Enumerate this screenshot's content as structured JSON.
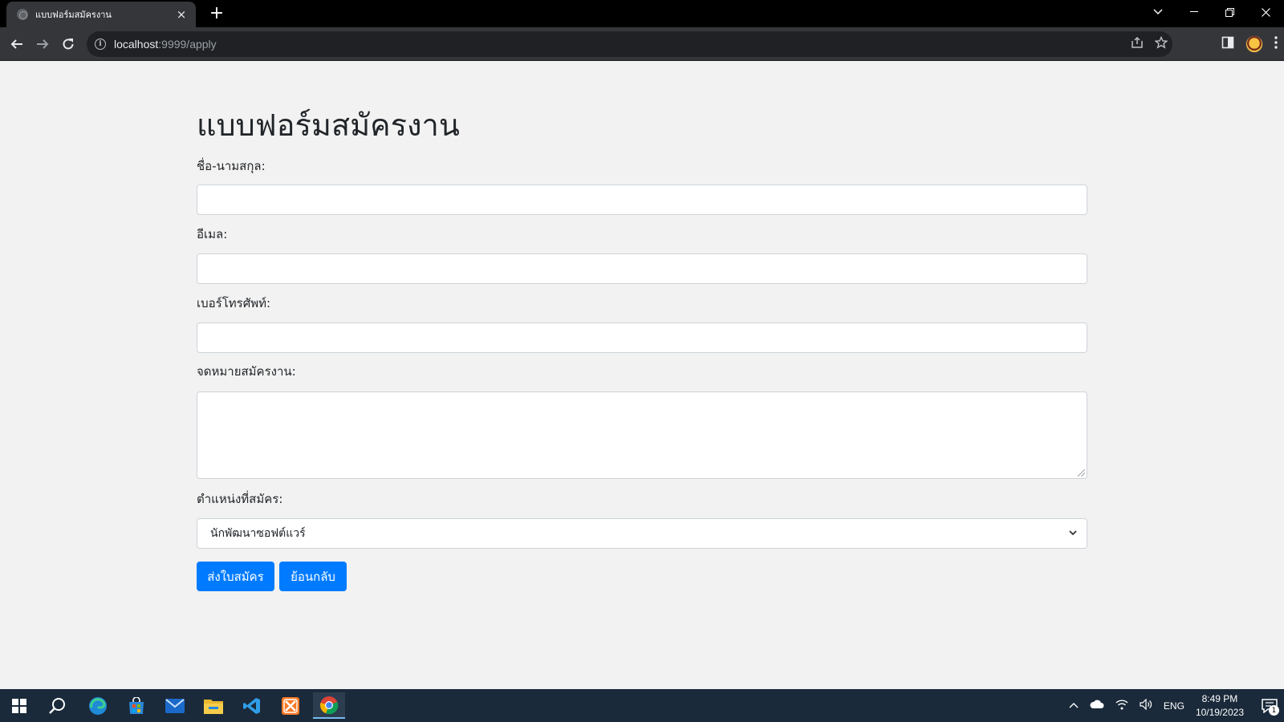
{
  "browser": {
    "tab_title": "แบบฟอร์มสมัครงาน",
    "tab_close": "×",
    "new_tab": "+",
    "url_host": "localhost",
    "url_rest": ":9999/apply"
  },
  "page": {
    "heading": "แบบฟอร์มสมัครงาน",
    "fields": {
      "name_label": "ชื่อ-นามสกุล:",
      "email_label": "อีเมล:",
      "phone_label": "เบอร์โทรศัพท์:",
      "cover_letter_label": "จดหมายสมัครงาน:",
      "position_label": "ตำแหน่งที่สมัคร:",
      "position_value": "นักพัฒนาซอฟต์แวร์"
    },
    "buttons": {
      "submit": "ส่งใบสมัคร",
      "back": "ย้อนกลับ"
    }
  },
  "taskbar": {
    "language": "ENG",
    "time": "8:49 PM",
    "date": "10/19/2023",
    "notification_count": "1"
  },
  "colors": {
    "primary_button": "#007bff",
    "page_background": "#f2f2f2",
    "taskbar": "#1a2a3a"
  }
}
